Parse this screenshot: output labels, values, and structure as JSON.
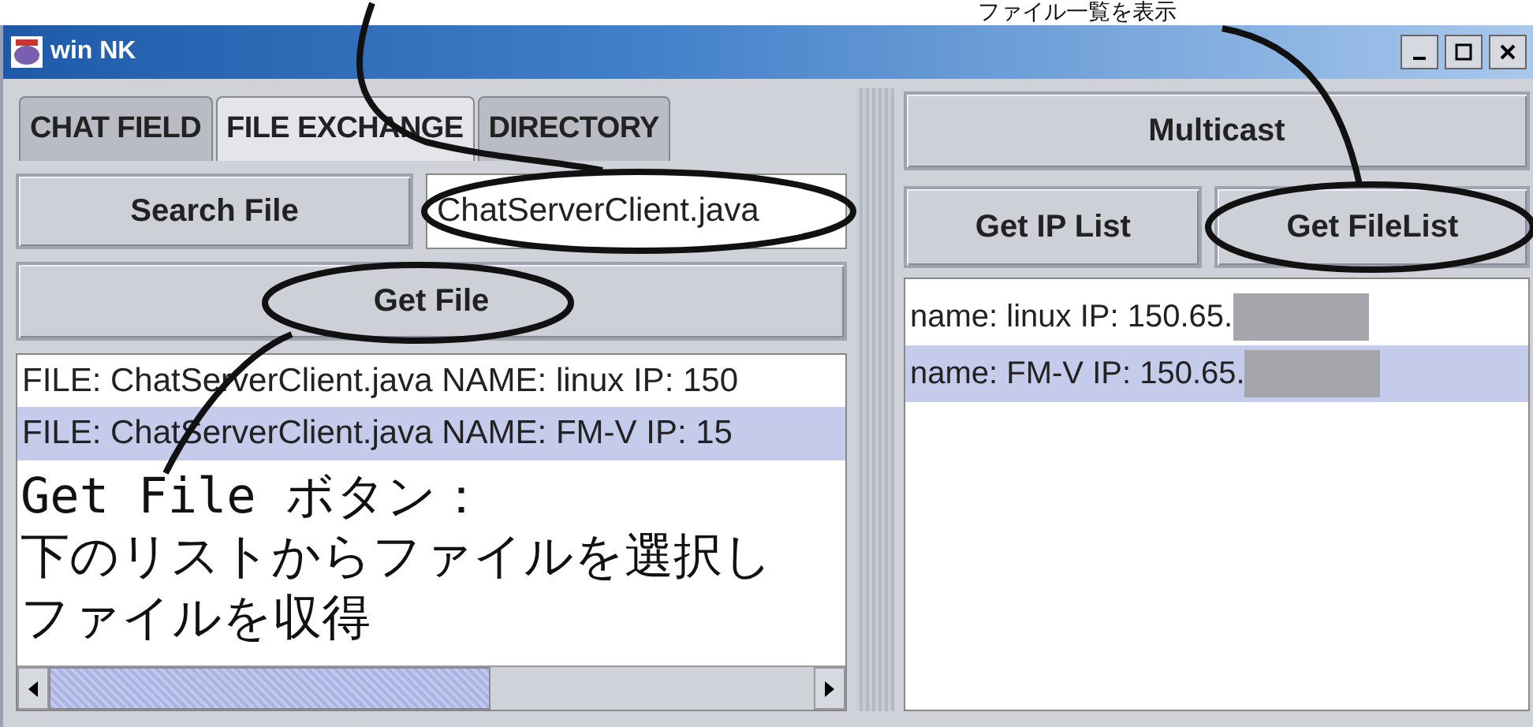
{
  "annotation_top": "ファイル一覧を表示",
  "window": {
    "title": "win NK"
  },
  "left_panel": {
    "tabs": [
      {
        "label": "CHAT FIELD",
        "selected": false
      },
      {
        "label": "FILE EXCHANGE",
        "selected": true
      },
      {
        "label": "DIRECTORY",
        "selected": false
      }
    ],
    "search_button": "Search File",
    "search_field": {
      "value": "ChatServerClient.java"
    },
    "get_file_button": "Get File",
    "file_list": [
      {
        "text": "FILE: ChatServerClient.java NAME: linux  IP: 150",
        "selected": false
      },
      {
        "text": "FILE: ChatServerClient.java NAME: FM-V  IP: 15",
        "selected": true
      }
    ],
    "note": [
      "Get File ボタン：",
      "下のリストからファイルを選択し",
      "ファイルを収得"
    ]
  },
  "right_panel": {
    "multicast_button": "Multicast",
    "buttons": [
      "Get IP List",
      "Get FileList"
    ],
    "host_list": [
      {
        "text": "name: linux  IP: 150.65.",
        "selected": false
      },
      {
        "text": "name: FM-V  IP: 150.65.",
        "selected": true
      }
    ]
  }
}
